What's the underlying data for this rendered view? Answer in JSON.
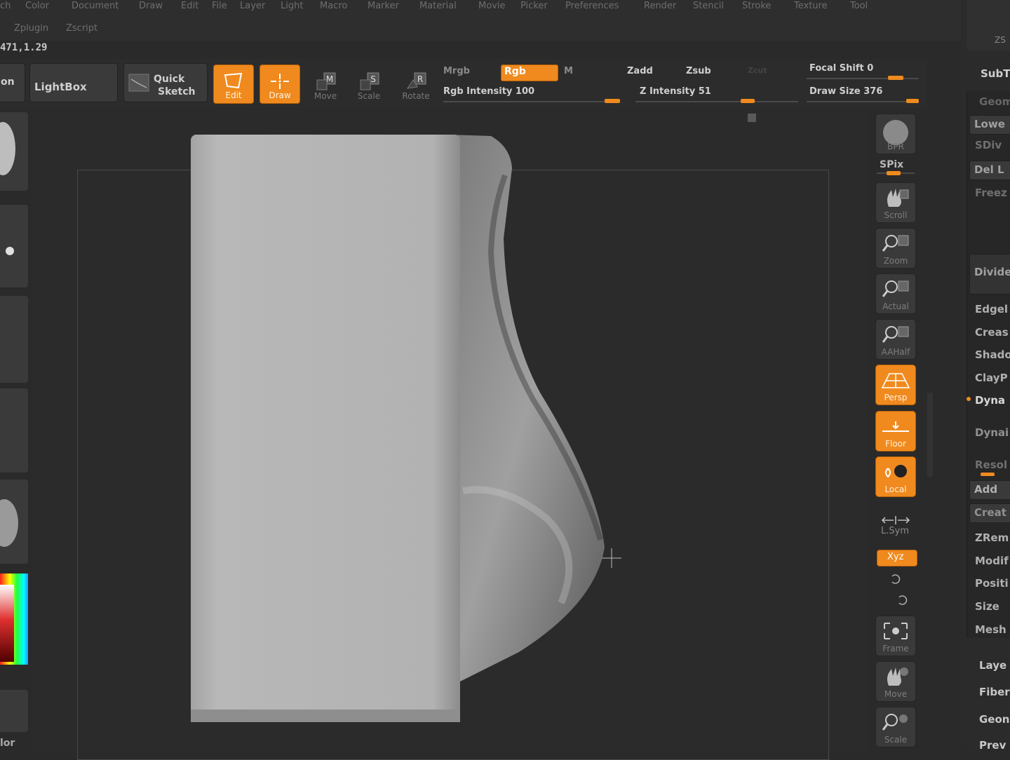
{
  "menu": {
    "row1": [
      "ch",
      "Color",
      "Document",
      "Draw",
      "Edit",
      "File",
      "Layer",
      "Light",
      "Macro",
      "Marker",
      "Material",
      "Movie",
      "Picker",
      "Preferences",
      "Render",
      "Stencil",
      "Stroke",
      "Texture",
      "Tool"
    ],
    "row2": [
      "Zplugin",
      "Zscript"
    ]
  },
  "coords": "471,1.29",
  "toolbar": {
    "on_label": "on",
    "lightbox": "LightBox",
    "quick": "Quick",
    "sketch": "Sketch",
    "edit": "Edit",
    "draw": "Draw",
    "move": "Move",
    "scale": "Scale",
    "rotate": "Rotate",
    "mrgb": "Mrgb",
    "rgb_btn": "Rgb",
    "m": "M",
    "rgb_intensity": "Rgb  Intensity 100",
    "zadd": "Zadd",
    "zsub": "Zsub",
    "zcut": "Zcut",
    "z_intensity": "Z Intensity 51",
    "focal_shift": "Focal Shift 0",
    "draw_size": "Draw Size 376",
    "rgb_intensity_value": 100,
    "z_intensity_value": 51,
    "draw_size_value": 376
  },
  "left_shelf": {
    "color_label": "lor"
  },
  "right_shelf": {
    "bpr": "BPR",
    "spix": "SPix",
    "scroll": "Scroll",
    "zoom": "Zoom",
    "actual": "Actual",
    "aahalf": "AAHalf",
    "persp": "Persp",
    "floor": "Floor",
    "local": "Local",
    "lsym": "L.Sym",
    "xyz": "Xyz",
    "frame": "Frame",
    "move": "Move",
    "scale": "Scale"
  },
  "right_panel": {
    "zs": "ZS",
    "subtool": "SubT",
    "geom": "Geom",
    "lower": "Lowe",
    "sdiv": "SDiv",
    "del": "Del L",
    "freeze": "Freez",
    "divide": "Divide",
    "edgeloop": "Edgel",
    "crease": "Creas",
    "shadow": "Shado",
    "claypolish": "ClayP",
    "dynamesh": "Dyna",
    "dynamic": "Dynai",
    "resolution": "Resol",
    "add": "Add",
    "create": "Creat",
    "zremesher": "ZRem",
    "modify": "Modif",
    "position": "Positi",
    "size": "Size",
    "mesh": "Mesh",
    "layers": "Laye",
    "fiber": "Fiber",
    "geometry": "Geon",
    "preview": "Prev"
  },
  "colors": {
    "accent": "#f08a1e",
    "background": "#2a2a2a"
  }
}
